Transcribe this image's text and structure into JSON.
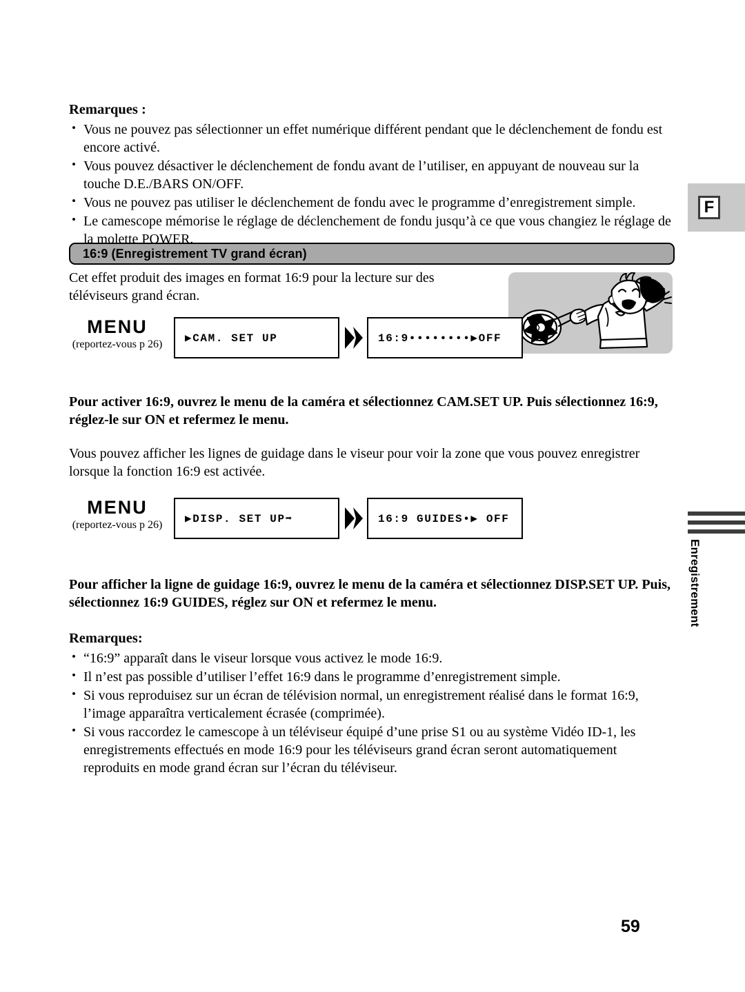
{
  "margin": {
    "language_tab": "F",
    "section_title_vertical": "Enregistrement"
  },
  "notes_top": {
    "heading": "Remarques :",
    "items": [
      "Vous ne pouvez pas sélectionner un effet numérique différent pendant que le déclenchement de fondu est encore activé.",
      "Vous pouvez désactiver le déclenchement de fondu avant de l’utiliser, en appuyant de nouveau sur la touche D.E./BARS ON/OFF.",
      "Vous ne pouvez pas utiliser le déclenchement de fondu avec le programme d’enregistrement simple.",
      "Le camescope mémorise le réglage de déclenchement de fondu jusqu’à ce que vous changiez le réglage de la molette POWER."
    ]
  },
  "section": {
    "heading": "16:9 (Enregistrement TV grand écran)",
    "intro": "Cet effet produit des images en format 16:9 pour la lecture sur des téléviseurs grand écran."
  },
  "menu_flow_1": {
    "menu_word": "MENU",
    "reference": "(reportez-vous p 26)",
    "screen_1": "▶CAM. SET UP",
    "screen_2": "16:9••••••••▶OFF"
  },
  "instruction_1": "Pour activer 16:9, ouvrez le menu de la caméra et sélectionnez CAM.SET UP. Puis sélectionnez 16:9, réglez-le sur ON et refermez le menu.",
  "paragraph_1": "Vous pouvez afficher les lignes de guidage dans le viseur pour voir la zone que vous pouvez enregistrer lorsque la fonction 16:9 est activée.",
  "menu_flow_2": {
    "menu_word": "MENU",
    "reference": "(reportez-vous p 26)",
    "screen_1": "▶DISP. SET UP➡",
    "screen_2": "16:9 GUIDES•▶ OFF"
  },
  "instruction_2": "Pour afficher la ligne de guidage 16:9, ouvrez le menu de la caméra et sélectionnez DISP.SET UP. Puis, sélectionnez 16:9 GUIDES, réglez sur ON et refermez le menu.",
  "notes_bottom": {
    "heading": "Remarques:",
    "items": [
      "“16:9” apparaît dans le viseur lorsque vous activez le mode 16:9.",
      "Il n’est pas possible d’utiliser l’effet 16:9 dans le programme d’enregistrement simple.",
      "Si vous reproduisez sur un écran de télévision normal, un enregistrement réalisé dans le format 16:9, l’image apparaîtra verticalement écrasée (comprimée).",
      "Si vous raccordez le camescope à un téléviseur équipé d’une prise S1 ou au système Vidéo ID-1, les enregistrements effectués en mode 16:9 pour les téléviseurs grand écran seront automatiquement reproduits en mode grand écran sur l’écran du téléviseur."
    ]
  },
  "page_number": "59",
  "illustration": {
    "description": "girl-playing-tennis"
  },
  "colors": {
    "tab_gray": "#c9c9c9",
    "section_bar_gray": "#a8a8a8",
    "rule_dark": "#3d3d3d"
  }
}
